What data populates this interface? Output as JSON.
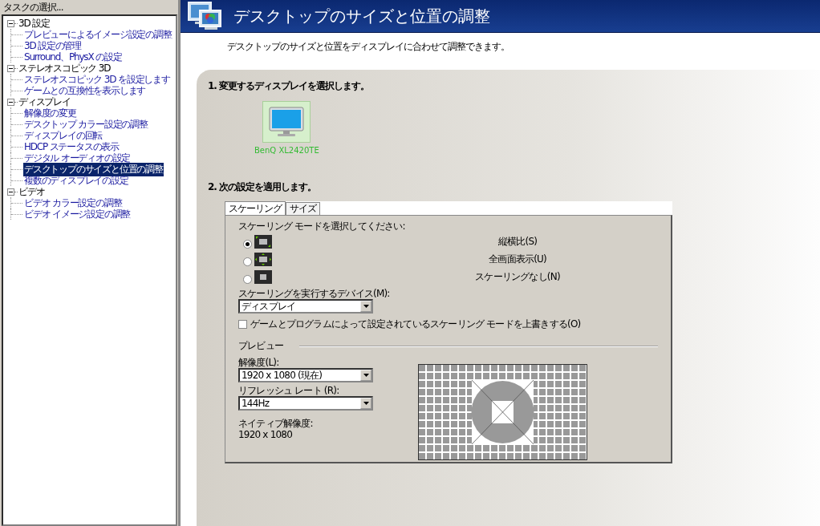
{
  "sidebar": {
    "title": "タスクの選択...",
    "tree": [
      {
        "label": "3D 設定",
        "expanded": true,
        "children": [
          {
            "label": "プレビューによるイメージ設定の調整",
            "selected": false
          },
          {
            "label": "3D 設定の管理",
            "selected": false
          },
          {
            "label": "Surround、PhysX の設定",
            "selected": false
          }
        ]
      },
      {
        "label": "ステレオスコピック 3D",
        "expanded": true,
        "children": [
          {
            "label": "ステレオスコピック 3D を設定します",
            "selected": false
          },
          {
            "label": "ゲームとの互換性を表示します",
            "selected": false
          }
        ]
      },
      {
        "label": "ディスプレイ",
        "expanded": true,
        "children": [
          {
            "label": "解像度の変更",
            "selected": false
          },
          {
            "label": "デスクトップ カラー設定の調整",
            "selected": false
          },
          {
            "label": "ディスプレイの回転",
            "selected": false
          },
          {
            "label": "HDCP ステータスの表示",
            "selected": false
          },
          {
            "label": "デジタル オーディオの設定",
            "selected": false
          },
          {
            "label": "デスクトップのサイズと位置の調整",
            "selected": true
          },
          {
            "label": "複数のディスプレイの設定",
            "selected": false
          }
        ]
      },
      {
        "label": "ビデオ",
        "expanded": true,
        "children": [
          {
            "label": "ビデオ カラー設定の調整",
            "selected": false
          },
          {
            "label": "ビデオ イメージ設定の調整",
            "selected": false
          }
        ]
      }
    ]
  },
  "header": {
    "title": "デスクトップのサイズと位置の調整",
    "description": "デスクトップのサイズと位置をディスプレイに合わせて調整できます。"
  },
  "section1": {
    "title": "1. 変更するディスプレイを選択します。",
    "displays": [
      {
        "name": "BenQ XL2420TE",
        "selected": true
      }
    ]
  },
  "section2": {
    "title": "2. 次の設定を適用します。",
    "tabs": [
      {
        "label": "スケーリング",
        "selected": true
      },
      {
        "label": "サイズ",
        "selected": false
      }
    ],
    "mode_prompt": "スケーリング モードを選択してください:",
    "modes": [
      {
        "label": "縦横比(S)",
        "kind": "aspect",
        "selected": true
      },
      {
        "label": "全画面表示(U)",
        "kind": "fullscreen",
        "selected": false
      },
      {
        "label": "スケーリングなし(N)",
        "kind": "none",
        "selected": false
      }
    ],
    "device_label": "スケーリングを実行するデバイス(M):",
    "device_value": "ディスプレイ",
    "override": {
      "label": "ゲームとプログラムによって設定されているスケーリング モードを上書きする(O)",
      "checked": false
    },
    "preview": {
      "title": "プレビュー",
      "resolution_label": "解像度(L):",
      "resolution_value": "1920 x 1080 (現在)",
      "refresh_label": "リフレッシュ レート (R):",
      "refresh_value": "144Hz",
      "native_label": "ネイティブ解像度:",
      "native_value": "1920 x 1080"
    }
  }
}
